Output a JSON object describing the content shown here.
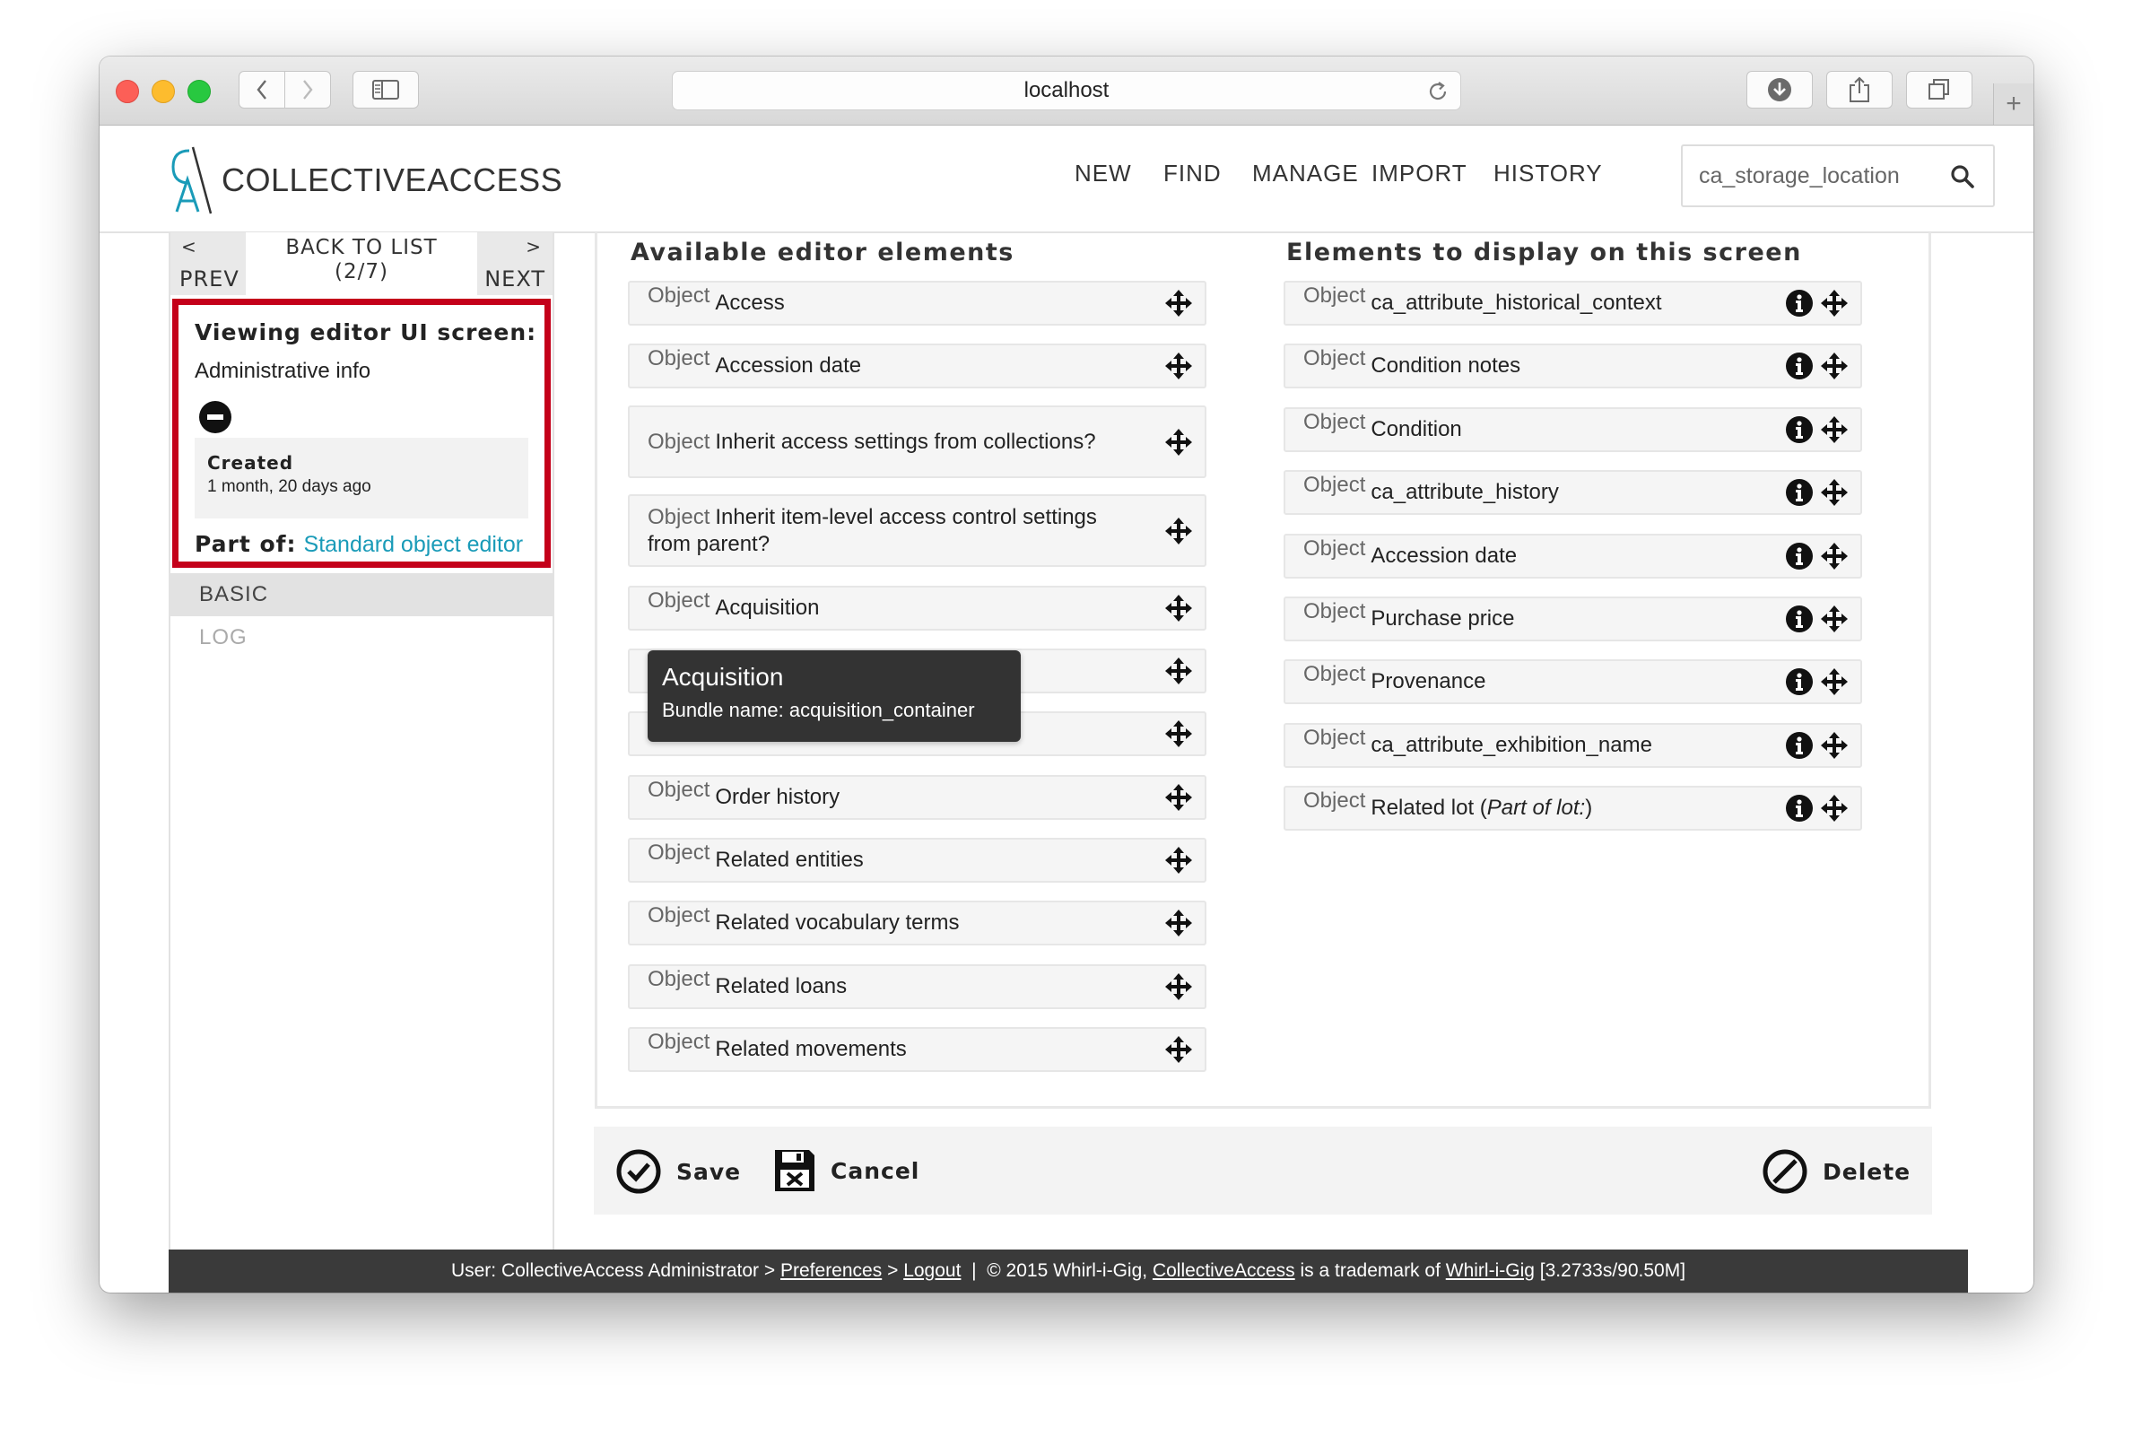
{
  "browser": {
    "url": "localhost",
    "new_tab": "+"
  },
  "app": {
    "logo_text": "COLLECTIVEACCESS",
    "nav": [
      "NEW",
      "FIND",
      "MANAGE",
      "IMPORT",
      "HISTORY"
    ],
    "search_value": "ca_storage_location"
  },
  "sidebar": {
    "prev": "PREV",
    "prev_arrow": "<",
    "next": "NEXT",
    "next_arrow": ">",
    "back_to_list": "BACK TO LIST",
    "position": "(2/7)",
    "viewing_title": "Viewing editor UI screen:",
    "screen_name": "Administrative info",
    "created_label": "Created",
    "created_value": "1 month, 20 days ago",
    "part_of_label": "Part of:",
    "part_of_value": "Standard object editor",
    "items": [
      {
        "label": "BASIC",
        "active": true
      },
      {
        "label": "LOG",
        "active": false
      }
    ]
  },
  "available": {
    "title": "Available editor elements",
    "prefix": "Object",
    "items": [
      "Access",
      "Accession date",
      "Inherit access settings from collections?",
      "Inherit item-level access control settings from parent?",
      "Acquisition",
      "",
      "",
      "Order history",
      "Related entities",
      "Related vocabulary terms",
      "Related loans",
      "Related movements"
    ]
  },
  "displayed": {
    "title": "Elements to display on this screen",
    "prefix": "Object",
    "items": [
      "ca_attribute_historical_context",
      "Condition notes",
      "Condition",
      "ca_attribute_history",
      "Accession date",
      "Purchase price",
      "Provenance",
      "ca_attribute_exhibition_name",
      "Related lot"
    ],
    "last_item_note": "Part of lot:"
  },
  "tooltip": {
    "title": "Acquisition",
    "bundle": "Bundle name: acquisition_container"
  },
  "actions": {
    "save": "Save",
    "cancel": "Cancel",
    "delete": "Delete"
  },
  "footer": {
    "user": "User: CollectiveAccess Administrator >",
    "preferences": "Preferences",
    "sep1": ">",
    "logout": "Logout",
    "sep2": "|",
    "copyright": "© 2015 Whirl-i-Gig,",
    "ca_link": "CollectiveAccess",
    "trademark": "is a trademark of",
    "wig_link": "Whirl-i-Gig",
    "stats": "[3.2733s/90.50M]"
  },
  "colors": {
    "accent_red": "#c4001a",
    "link": "#1a9bb8",
    "footer_bg": "#3a3a3a"
  },
  "icons": {
    "move": "four-way-arrow-icon",
    "info": "info-circle-icon",
    "save": "check-circle-icon",
    "cancel": "floppy-x-icon",
    "delete": "no-entry-icon",
    "remove": "minus-circle-icon"
  }
}
